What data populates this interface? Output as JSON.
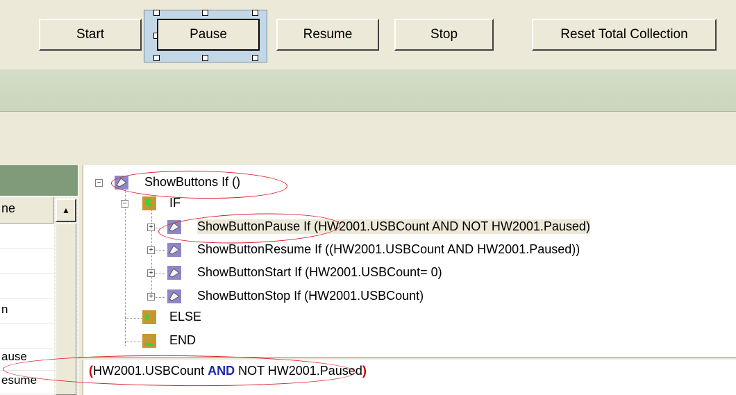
{
  "toolbar": {
    "start_label": "Start",
    "pause_label": "Pause",
    "resume_label": "Resume",
    "stop_label": "Stop",
    "reset_label": "Reset Total Collection"
  },
  "left_list": {
    "column_header": "ne",
    "rows": [
      "",
      "",
      "",
      "n",
      "",
      "ause",
      "esume"
    ]
  },
  "tree": {
    "root": "ShowButtons If ()",
    "if_label": "IF",
    "children": [
      "ShowButtonPause If (HW2001.USBCount AND NOT HW2001.Paused)",
      "ShowButtonResume If ((HW2001.USBCount AND HW2001.Paused))",
      "ShowButtonStart If (HW2001.USBCount= 0)",
      "ShowButtonStop If (HW2001.USBCount)"
    ],
    "else_label": "ELSE",
    "end_label": "END"
  },
  "expression": {
    "open_paren": "(",
    "part1": "HW2001.USBCount ",
    "and_kw": "AND",
    "part2": " NOT HW2001.Paused",
    "close_paren": ")"
  },
  "colors": {
    "highlight_ellipse": "#d8202a",
    "keyword": "#1e2aa8",
    "paren": "#cc0000",
    "header_green": "#7f9b7a"
  }
}
